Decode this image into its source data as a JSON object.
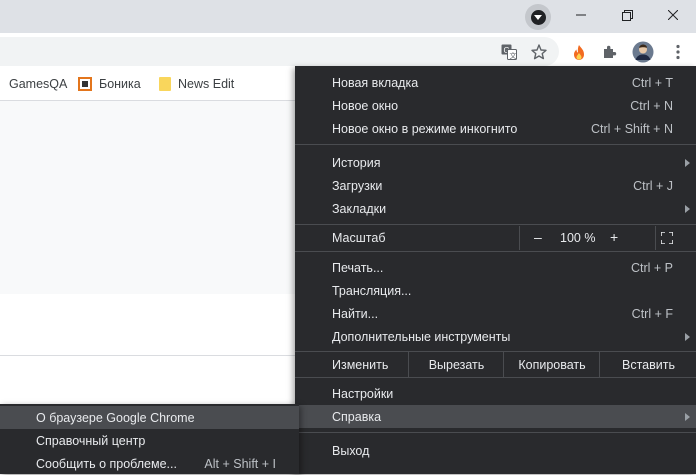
{
  "bookmarks": [
    {
      "label": "GamesQA"
    },
    {
      "label": "Боника"
    },
    {
      "label": "News Edit"
    }
  ],
  "zoom": {
    "label": "Масштаб",
    "minus": "–",
    "value": "100 %",
    "plus": "+"
  },
  "menu": {
    "group1": [
      {
        "label": "Новая вкладка",
        "shortcut": "Ctrl + T"
      },
      {
        "label": "Новое окно",
        "shortcut": "Ctrl + N"
      },
      {
        "label": "Новое окно в режиме инкогнито",
        "shortcut": "Ctrl + Shift + N"
      }
    ],
    "group2": [
      {
        "label": "История"
      },
      {
        "label": "Загрузки",
        "shortcut": "Ctrl + J"
      },
      {
        "label": "Закладки"
      }
    ],
    "group3": [
      {
        "label": "Печать...",
        "shortcut": "Ctrl + P"
      },
      {
        "label": "Трансляция..."
      },
      {
        "label": "Найти...",
        "shortcut": "Ctrl + F"
      },
      {
        "label": "Дополнительные инструменты"
      }
    ],
    "edit": {
      "label": "Изменить",
      "cut": "Вырезать",
      "copy": "Копировать",
      "paste": "Вставить"
    },
    "settings": "Настройки",
    "help": "Справка",
    "exit": "Выход"
  },
  "submenu": [
    {
      "label": "О браузере Google Chrome"
    },
    {
      "label": "Справочный центр"
    },
    {
      "label": "Сообщить о проблеме...",
      "shortcut": "Alt + Shift + I"
    }
  ],
  "icons": {
    "tab_search": "tab-search-icon",
    "translate": "translate-icon",
    "bookmark_star": "star-icon",
    "extension_fire": "fire-extension-icon",
    "extensions": "puzzle-icon",
    "profile": "avatar",
    "menu": "kebab-menu-icon"
  },
  "colors": {
    "menu_bg": "#292a2d",
    "menu_highlight": "#4a4c50",
    "titlebar": "#dee1e6"
  }
}
